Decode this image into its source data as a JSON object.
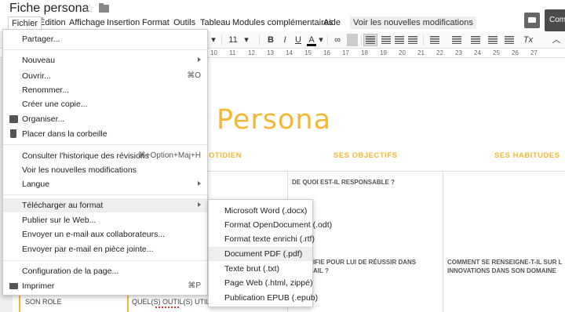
{
  "doc": {
    "title": "Fiche persona"
  },
  "menubar": {
    "items": [
      "Fichier",
      "Édition",
      "Affichage",
      "Insertion",
      "Format",
      "Outils",
      "Tableau",
      "Modules complémentaires",
      "Aide"
    ],
    "hint": "Voir les nouvelles modifications"
  },
  "share": {
    "label": "Com"
  },
  "toolbar": {
    "font_size": "11",
    "bold": "B",
    "italic": "I",
    "underline": "U",
    "text_color": "A",
    "clear_format": "Tx"
  },
  "ruler": {
    "numbers": [
      "10",
      "11",
      "12",
      "13",
      "14",
      "15",
      "16",
      "17",
      "18",
      "19",
      "20",
      "21",
      "22",
      "23",
      "24",
      "25",
      "26",
      "27"
    ]
  },
  "document": {
    "title": "Persona",
    "col_quotidien": "OTIDIEN",
    "col_objectifs": "SES OBJECTIFS",
    "col_habitudes": "SES HABITUDES",
    "cell_responsable": "DE QUOI EST-IL RESPONSABLE ?",
    "cell_reussir_1": "IFIE POUR LUI DE RÉUSSIR DANS",
    "cell_reussir_2": "AIL ?",
    "cell_renseigne_1": "COMMENT SE RENSEIGNE-T-IL SUR L",
    "cell_renseigne_2": "INNOVATIONS DANS SON DOMAINE",
    "son_role": "SON ROLE",
    "outils": "QUEL(S) OUTIL(S) UTILIS"
  },
  "file_menu": {
    "partager": "Partager...",
    "nouveau": "Nouveau",
    "ouvrir": "Ouvrir...",
    "ouvrir_shortcut": "⌘O",
    "renommer": "Renommer...",
    "copie": "Créer une copie...",
    "organiser": "Organiser...",
    "corbeille": "Placer dans la corbeille",
    "historique": "Consulter l'historique des révisions",
    "historique_shortcut": "⌘+Option+Maj+H",
    "modifications": "Voir les nouvelles modifications",
    "langue": "Langue",
    "telecharger": "Télécharger au format",
    "publier": "Publier sur le Web...",
    "email_collab": "Envoyer un e-mail aux collaborateurs...",
    "email_piece": "Envoyer par e-mail en pièce jointe...",
    "configuration": "Configuration de la page...",
    "imprimer": "Imprimer",
    "imprimer_shortcut": "⌘P"
  },
  "download_submenu": {
    "items": [
      "Microsoft Word (.docx)",
      "Format OpenDocument (.odt)",
      "Format texte enrichi (.rtf)",
      "Document PDF (.pdf)",
      "Texte brut (.txt)",
      "Page Web (.html, zippé)",
      "Publication EPUB (.epub)"
    ]
  },
  "colors": {
    "accent": "#f4b834",
    "menu_highlight": "#eeeeee"
  }
}
